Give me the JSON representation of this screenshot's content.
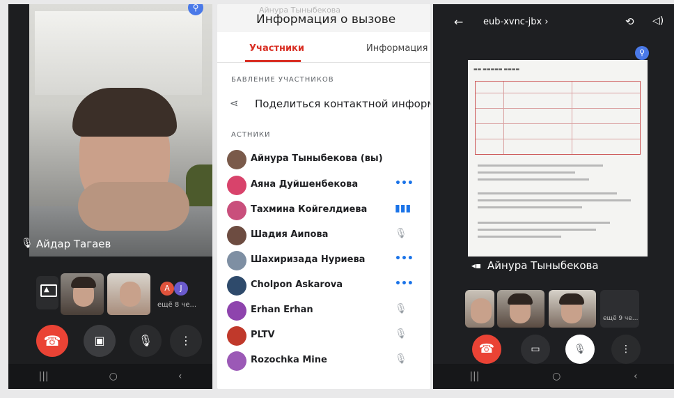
{
  "left_phone": {
    "caller_name": "Айдар Тагаев",
    "more_participants": "ещё 8 че...",
    "avatar_letters": [
      "A",
      "J"
    ],
    "icons": {
      "mic": "mic-off-icon",
      "pin": "pin-icon",
      "present": "present-screen-icon",
      "end_call": "end-call-icon",
      "camera": "camera-off-icon",
      "microphone": "mic-icon",
      "menu": "more-vert-icon"
    }
  },
  "middle_phone": {
    "faded_header": "Айнура Тыныбекова",
    "title": "Информация о вызове",
    "tabs": [
      {
        "label": "Участники",
        "active": true
      },
      {
        "label": "Информация",
        "active": false
      }
    ],
    "add_section_header": "БАВЛЕНИЕ УЧАСТНИКОВ",
    "share_contact_label": "Поделиться контактной информаци",
    "participants_header": "АСТНИКИ",
    "participants": [
      {
        "name": "Айнура Тыныбекова (вы)",
        "status": "",
        "avatar_color": "#7a5a4a"
      },
      {
        "name": "Аяна Дуйшенбекова",
        "status": "•••",
        "avatar_color": "#d8436b"
      },
      {
        "name": "Тахмина Койгелдиева",
        "status": "▮▮▮",
        "avatar_color": "#c94f7c"
      },
      {
        "name": "Шадия Аипова",
        "status": "🎙",
        "avatar_color": "#6d4c41"
      },
      {
        "name": "Шахиризада Нуриева",
        "status": "•••",
        "avatar_color": "#7e8fa3"
      },
      {
        "name": "Cholpon Askarova",
        "status": "•••",
        "avatar_color": "#2e4a6b"
      },
      {
        "name": "Erhan Erhan",
        "status": "🎙",
        "avatar_color": "#8e44ad"
      },
      {
        "name": "PLTV",
        "status": "🎙",
        "avatar_color": "#c0392b"
      },
      {
        "name": "Rozochka Mine",
        "status": "🎙",
        "avatar_color": "#9b59b6"
      }
    ],
    "accent_color": "#d93025"
  },
  "right_phone": {
    "meet_code": "eub-xvnc-jbx ›",
    "presenter_name": "Айнура Тыныбекова",
    "more_participants": "ещё 9 че...",
    "icons": {
      "back": "back-arrow-icon",
      "switch_camera": "switch-camera-icon",
      "volume": "volume-icon",
      "end_call": "end-call-icon",
      "camera": "camera-icon",
      "microphone": "mic-off-icon",
      "menu": "more-vert-icon"
    }
  },
  "nav": {
    "recents": "|||",
    "home": "○",
    "back": "‹"
  }
}
